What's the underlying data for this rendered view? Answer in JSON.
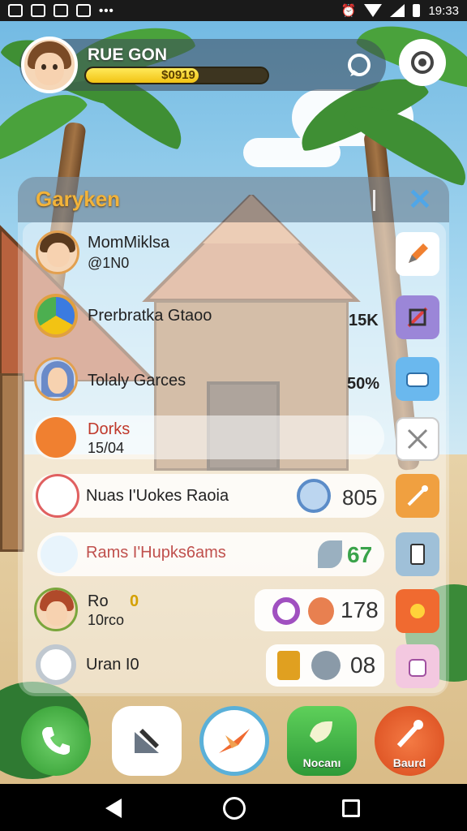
{
  "status_bar": {
    "time": "19:33"
  },
  "player": {
    "name": "RUE GON",
    "xp_label": "$0919",
    "xp_fraction": 0.62
  },
  "panel": {
    "title": "Garyken"
  },
  "list": [
    {
      "name": "MomMiklsa",
      "sub": "@1N0",
      "value": ""
    },
    {
      "name": "Prerbratka Gtaoo",
      "sub": "",
      "value": "15K"
    },
    {
      "name": "Tolaly Garces",
      "sub": "",
      "value": "50%"
    },
    {
      "name": "Dorks",
      "sub": "15/04",
      "value": ""
    },
    {
      "name": "Nuas I'Uokes Raoia",
      "sub": "",
      "value": "805"
    },
    {
      "name": "Rams I'Hupks6ams",
      "sub": "",
      "value": "67"
    },
    {
      "name": "Ro",
      "sub": "10rco",
      "value": "0"
    },
    {
      "name": "Uran I0",
      "sub": "",
      "value": ""
    }
  ],
  "pills": {
    "p1": "178",
    "p2": "08"
  },
  "dock": {
    "green_label": "Nocanı",
    "red_label": "Baurd"
  },
  "colors": {
    "accent_gold": "#f2b33a",
    "xp_yellow": "#f2c313",
    "close_blue": "#4fa6e8",
    "value_green": "#3aa34a"
  },
  "icons": [
    "phone-icon",
    "tools-icon",
    "plane-icon",
    "leaf-icon",
    "pen-icon",
    "camera-icon",
    "chat-icon",
    "close-icon"
  ]
}
